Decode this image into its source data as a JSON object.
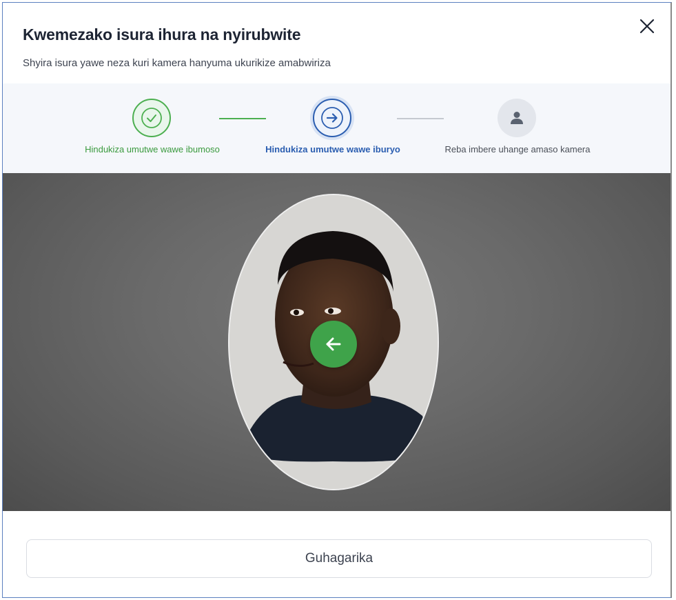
{
  "modal": {
    "title": "Kwemezako isura ihura na nyirubwite",
    "subtitle": "Shyira isura yawe neza kuri kamera hanyuma ukurikize amabwiriza"
  },
  "steps": [
    {
      "label": "Hindukiza umutwe wawe ibumoso",
      "status": "completed",
      "icon": "check-icon"
    },
    {
      "label": "Hindukiza umutwe wawe iburyo",
      "status": "active",
      "icon": "arrow-right-icon"
    },
    {
      "label": "Reba imbere uhange amaso kamera",
      "status": "pending",
      "icon": "user-icon"
    }
  ],
  "camera": {
    "overlay_icon": "arrow-left-icon"
  },
  "footer": {
    "cancel_label": "Guhagarika"
  },
  "colors": {
    "completed": "#4caf50",
    "active": "#2a5db0",
    "pending": "#9aa0aa",
    "overlay_badge": "#3fa34a"
  }
}
